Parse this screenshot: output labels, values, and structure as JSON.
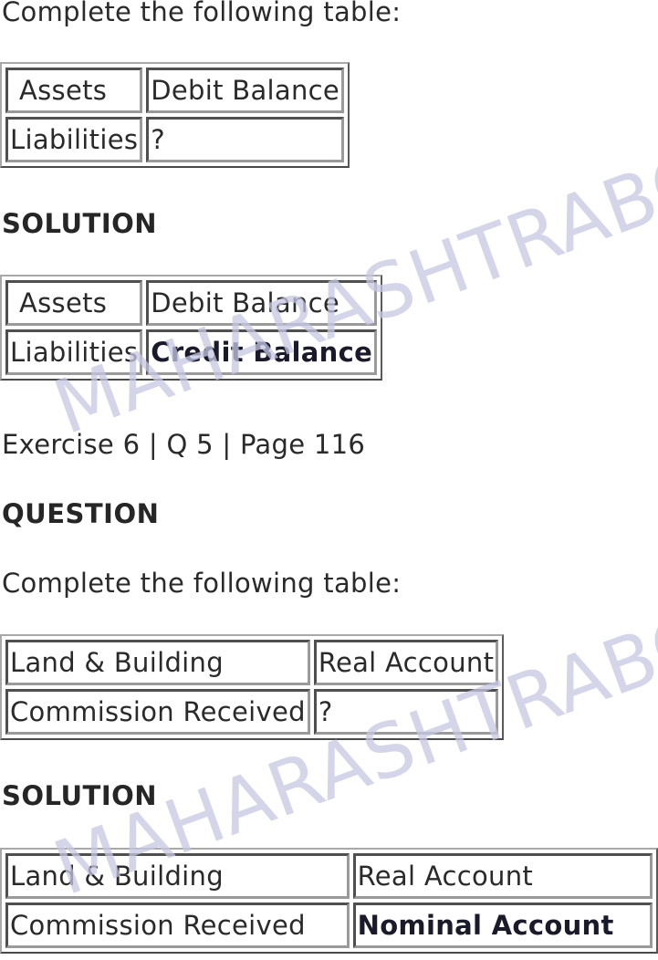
{
  "blocks": [
    {
      "prompt": "Complete the following table:",
      "question_table": {
        "rows": [
          [
            "Assets",
            "Debit Balance"
          ],
          [
            "Liabilities",
            "?"
          ]
        ]
      },
      "solution_heading": "SOLUTION",
      "solution_table": {
        "rows": [
          [
            "Assets",
            "Debit Balance"
          ],
          [
            "Liabilities",
            "Credit Balance"
          ]
        ],
        "answer": "Credit Balance"
      }
    },
    {
      "reference": "Exercise 6 | Q 5 | Page 116",
      "question_heading": "QUESTION",
      "prompt": "Complete the following table:",
      "question_table": {
        "rows": [
          [
            "Land & Building",
            "Real Account"
          ],
          [
            "Commission Received",
            "?"
          ]
        ]
      },
      "solution_heading": "SOLUTION",
      "solution_table": {
        "rows": [
          [
            "Land & Building",
            "Real Account"
          ],
          [
            "Commission Received",
            "Nominal Account"
          ]
        ],
        "answer": "Nominal Account"
      }
    }
  ],
  "watermark": {
    "text": "MAHARASHTRABOARD",
    "color": "#c7c8e4"
  },
  "colors": {
    "text": "#2a2a2a",
    "answer": "#1a1a2a"
  }
}
